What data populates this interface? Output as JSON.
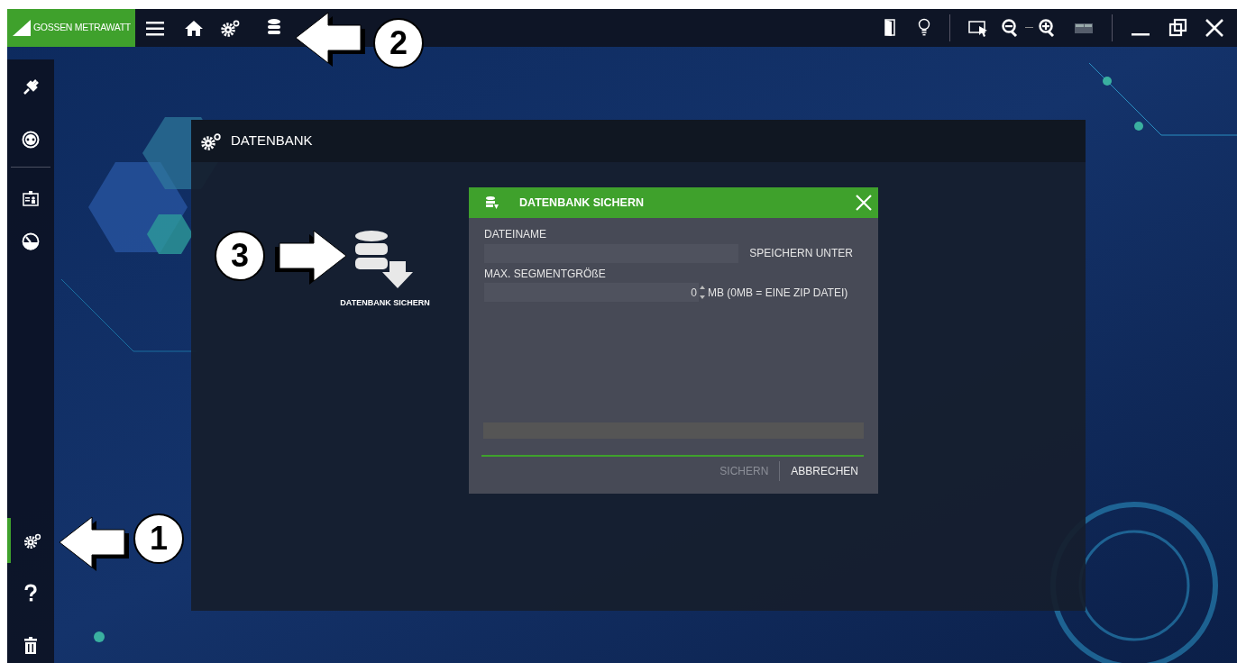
{
  "top_bar": {
    "logo": "GOSSEN METRAWATT"
  },
  "sidebar": {
    "items": [
      {
        "kind": "plug",
        "selected": false
      },
      {
        "kind": "socket",
        "selected": false
      },
      {
        "kind": "badge",
        "selected": false
      },
      {
        "kind": "gauge",
        "selected": false
      },
      {
        "kind": "settings",
        "selected": true
      },
      {
        "kind": "help",
        "selected": false
      },
      {
        "kind": "trash",
        "selected": false
      }
    ]
  },
  "panel": {
    "title": "DATENBANK",
    "tiles": [
      {
        "label": "DATENBANK SICHERN"
      }
    ]
  },
  "dialog": {
    "title": "DATENBANK SICHERN",
    "file_label": "DATEINAME",
    "browse_button": "SPEICHERN UNTER",
    "segment_label": "MAX. SEGMENTGRÖßE",
    "segment_value": "0",
    "segment_unit": "MB (0MB = EINE ZIP DATEI)",
    "buttons": [
      {
        "label": "SICHERN",
        "disabled": true
      },
      {
        "label": "ABBRECHEN",
        "disabled": false
      }
    ]
  },
  "callouts": [
    {
      "number": "1"
    },
    {
      "number": "2"
    },
    {
      "number": "3"
    }
  ]
}
